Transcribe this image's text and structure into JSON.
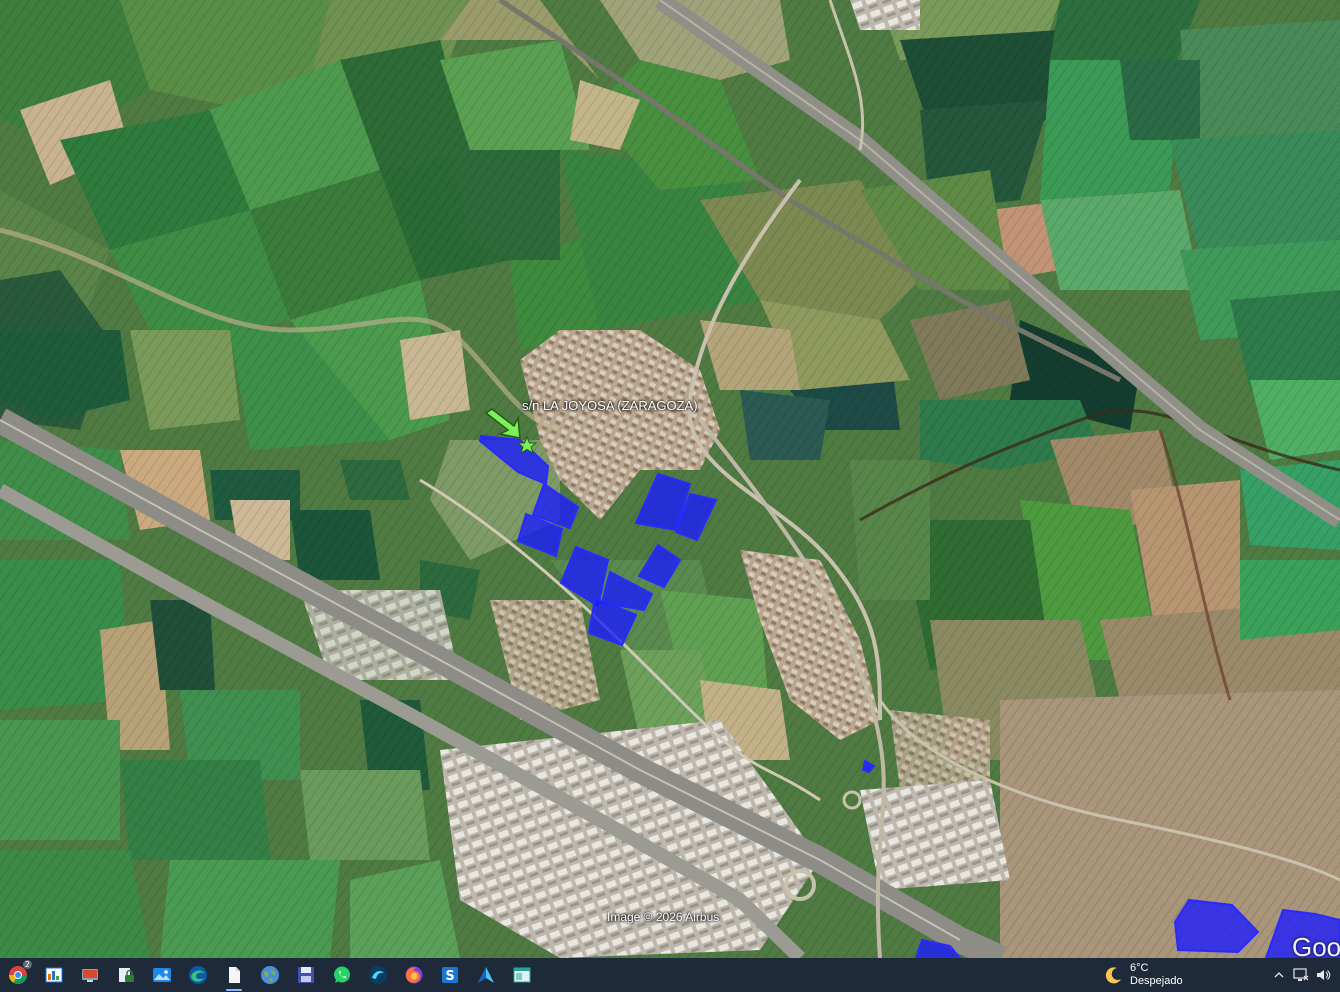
{
  "map": {
    "placemark_label": "s/n LA JOYOSA (ZARAGOZA)",
    "attribution": "Image © 2026 Airbus",
    "logo_partial": "Goo",
    "parcel_color": "#1a1aff",
    "arrow_color": "#7bf05a"
  },
  "taskbar": {
    "apps": [
      {
        "name": "chrome",
        "badge": "2"
      },
      {
        "name": "folder-app"
      },
      {
        "name": "monitor-app"
      },
      {
        "name": "secure-files"
      },
      {
        "name": "photos"
      },
      {
        "name": "edge"
      },
      {
        "name": "notepad",
        "active": true
      },
      {
        "name": "google-earth"
      },
      {
        "name": "save-disk"
      },
      {
        "name": "whatsapp"
      },
      {
        "name": "app-blue-wave"
      },
      {
        "name": "firefox"
      },
      {
        "name": "app-s-blue"
      },
      {
        "name": "app-arrow"
      },
      {
        "name": "app-window"
      }
    ],
    "weather": {
      "temperature": "6°C",
      "description": "Despejado"
    }
  }
}
